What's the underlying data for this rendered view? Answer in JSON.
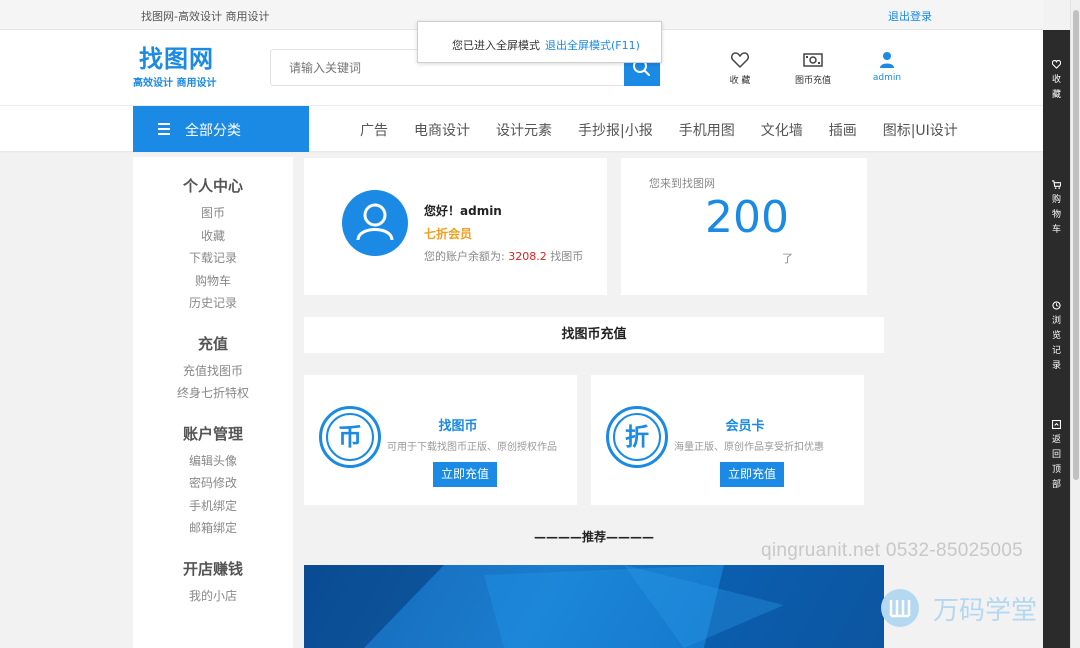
{
  "topbar": {
    "slogan": "找图网-高效设计 商用设计",
    "logout": "退出登录"
  },
  "fullscreen_toast": {
    "message": "您已进入全屏模式",
    "exit": "退出全屏模式(F11)"
  },
  "header": {
    "logo_title": "找图网",
    "logo_subtitle": "高效设计 商用设计",
    "search_placeholder": "请输入关键词",
    "favorites": "收 藏",
    "recharge": "图币充值",
    "user": "admin"
  },
  "nav": {
    "all_categories": "全部分类",
    "items": [
      "广告",
      "电商设计",
      "设计元素",
      "手抄报|小报",
      "手机用图",
      "文化墙",
      "插画",
      "图标|UI设计"
    ]
  },
  "sidebar": {
    "groups": [
      {
        "title": "个人中心",
        "items": [
          "图币",
          "收藏",
          "下载记录",
          "购物车",
          "历史记录"
        ]
      },
      {
        "title": "充值",
        "items": [
          "充值找图币",
          "终身七折特权"
        ]
      },
      {
        "title": "账户管理",
        "items": [
          "编辑头像",
          "密码修改",
          "手机绑定",
          "邮箱绑定"
        ]
      },
      {
        "title": "开店赚钱",
        "items": [
          "我的小店"
        ]
      }
    ]
  },
  "user_card": {
    "greeting": "您好！admin",
    "vip": "七折会员",
    "balance_label": "您的账户余额为:",
    "balance_value": "3208.2",
    "balance_unit": "找图币"
  },
  "days_card": {
    "prefix": "您来到找图网",
    "days": "200",
    "suffix": "了"
  },
  "recharge_section": {
    "title": "找图币充值",
    "cards": [
      {
        "glyph": "币",
        "title": "找图币",
        "desc": "可用于下载找图币正版、原创授权作品",
        "button": "立即充值"
      },
      {
        "glyph": "折",
        "title": "会员卡",
        "desc": "海量正版、原创作品享受折扣优惠",
        "button": "立即充值"
      }
    ]
  },
  "recommend": "————推荐————",
  "watermark": {
    "line1": "qingruanit.net 0532-85025005",
    "line2": "万码学堂"
  },
  "rightbar": {
    "items": [
      {
        "icon": "heart-icon",
        "label": [
          "收",
          "藏"
        ]
      },
      {
        "icon": "cart-icon",
        "label": [
          "购",
          "物",
          "车"
        ]
      },
      {
        "icon": "clock-icon",
        "label": [
          "浏",
          "览",
          "记",
          "录"
        ]
      },
      {
        "icon": "top-icon",
        "label": [
          "返",
          "回",
          "顶",
          "部"
        ]
      }
    ]
  },
  "colors": {
    "primary": "#1a8ae5",
    "vip": "#f0a020",
    "balance": "#e02020",
    "rightbar": "#2b2b2b"
  }
}
